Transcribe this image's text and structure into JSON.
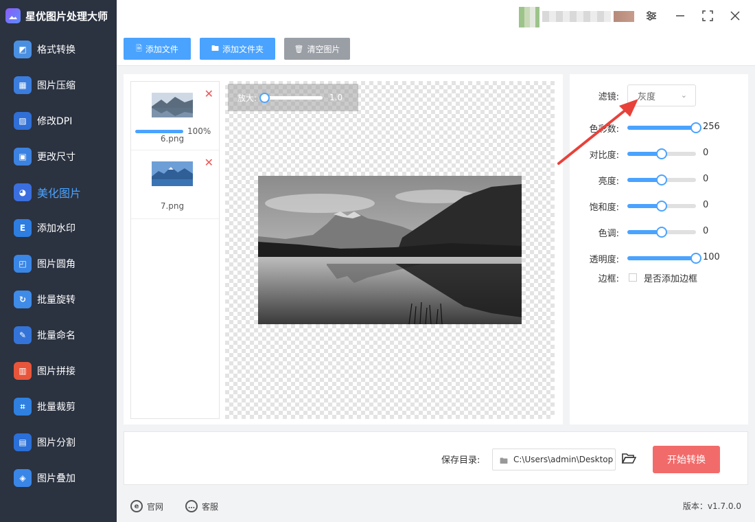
{
  "app": {
    "title": "星优图片处理大师"
  },
  "sidebar": {
    "items": [
      {
        "label": "格式转换",
        "icon": "image-convert-icon",
        "color": "#4a90e2",
        "active": false
      },
      {
        "label": "图片压缩",
        "icon": "image-compress-icon",
        "color": "#3b7ddd",
        "active": false
      },
      {
        "label": "修改DPI",
        "icon": "dpi-icon",
        "color": "#2f6fd6",
        "active": false
      },
      {
        "label": "更改尺寸",
        "icon": "resize-icon",
        "color": "#3c82e0",
        "active": false
      },
      {
        "label": "美化图片",
        "icon": "beautify-icon",
        "color": "#3b6fe0",
        "active": true
      },
      {
        "label": "添加水印",
        "icon": "watermark-icon",
        "color": "#2e7de1",
        "active": false
      },
      {
        "label": "图片圆角",
        "icon": "round-corner-icon",
        "color": "#3a86e6",
        "active": false
      },
      {
        "label": "批量旋转",
        "icon": "rotate-icon",
        "color": "#3f8be8",
        "active": false
      },
      {
        "label": "批量命名",
        "icon": "rename-icon",
        "color": "#3474d9",
        "active": false
      },
      {
        "label": "图片拼接",
        "icon": "stitch-icon",
        "color": "#e8553a",
        "active": false
      },
      {
        "label": "批量裁剪",
        "icon": "crop-icon",
        "color": "#2f80e0",
        "active": false
      },
      {
        "label": "图片分割",
        "icon": "split-icon",
        "color": "#2b6fd8",
        "active": false
      },
      {
        "label": "图片叠加",
        "icon": "layers-icon",
        "color": "#3a86e6",
        "active": false
      }
    ]
  },
  "toolbar": {
    "add_file": "添加文件",
    "add_folder": "添加文件夹",
    "clear": "清空图片",
    "add_color": "#4aa3ff",
    "clear_color": "#9a9fa6"
  },
  "files": [
    {
      "name": "6.png",
      "progress": "100%",
      "progress_value": 100
    },
    {
      "name": "7.png"
    }
  ],
  "zoom": {
    "label": "放大:",
    "value": "1.0"
  },
  "settings": {
    "filter_label": "滤镜:",
    "filter_value": "灰度",
    "sliders": [
      {
        "label": "色彩数:",
        "value": "256",
        "fraction": 1.0
      },
      {
        "label": "对比度:",
        "value": "0",
        "fraction": 0.5
      },
      {
        "label": "亮度:",
        "value": "0",
        "fraction": 0.5
      },
      {
        "label": "饱和度:",
        "value": "0",
        "fraction": 0.5
      },
      {
        "label": "色调:",
        "value": "0",
        "fraction": 0.5
      },
      {
        "label": "透明度:",
        "value": "100",
        "fraction": 1.0
      }
    ],
    "border_label": "边框:",
    "border_checkbox_label": "是否添加边框"
  },
  "output": {
    "save_label": "保存目录:",
    "save_path": "C:\\Users\\admin\\Desktop",
    "start_button": "开始转换",
    "start_color": "#f26b6b"
  },
  "footer": {
    "website": "官网",
    "support": "客服",
    "version": "版本：v1.7.0.0"
  },
  "accent": "#4aa3ff",
  "annotation_color": "#e8413a"
}
